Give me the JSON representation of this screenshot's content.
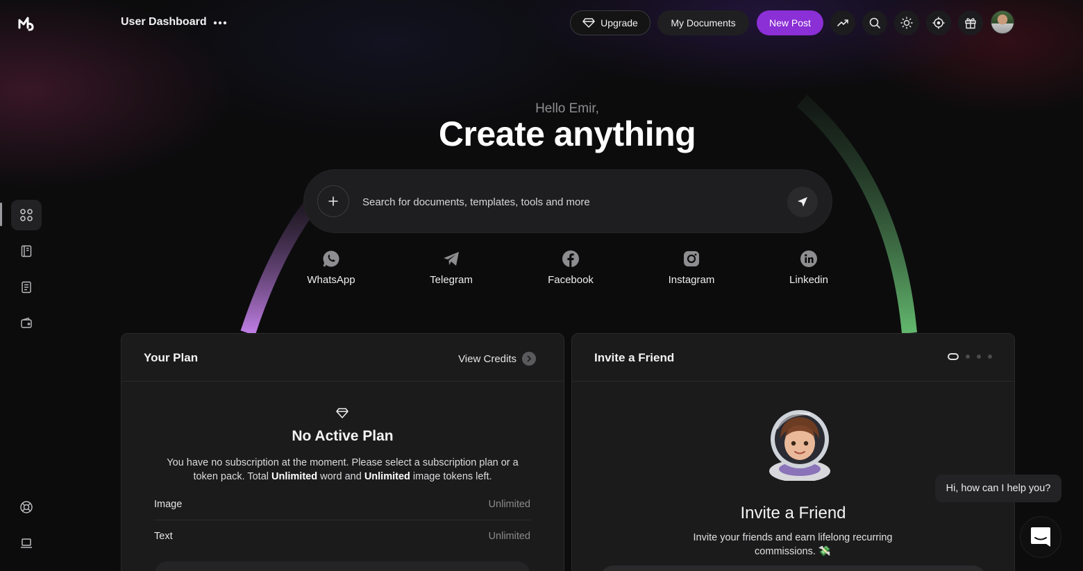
{
  "header": {
    "title": "User Dashboard",
    "upgrade_label": "Upgrade",
    "docs_label": "My Documents",
    "new_post_label": "New Post"
  },
  "sidebar": {
    "items": [
      {
        "icon": "grid-icon",
        "active": true
      },
      {
        "icon": "book-icon"
      },
      {
        "icon": "document-icon"
      },
      {
        "icon": "wallet-icon"
      },
      {
        "icon": "lifebuoy-icon"
      },
      {
        "icon": "laptop-icon"
      }
    ]
  },
  "hero": {
    "greeting": "Hello Emir,",
    "headline": "Create anything",
    "search_placeholder": "Search for documents, templates, tools and more"
  },
  "socials": [
    {
      "label": "WhatsApp",
      "icon": "whatsapp-icon"
    },
    {
      "label": "Telegram",
      "icon": "telegram-icon"
    },
    {
      "label": "Facebook",
      "icon": "facebook-icon"
    },
    {
      "label": "Instagram",
      "icon": "instagram-icon"
    },
    {
      "label": "Linkedin",
      "icon": "linkedin-icon"
    }
  ],
  "plan": {
    "card_title": "Your Plan",
    "view_credits": "View Credits",
    "title": "No Active Plan",
    "desc_1": "You have no subscription at the moment. Please select a subscription plan or a token pack. Total ",
    "unlimited_1": "Unlimited",
    "desc_2": " word and ",
    "unlimited_2": "Unlimited",
    "desc_3": " image tokens left.",
    "rows": [
      {
        "label": "Image",
        "value": "Unlimited"
      },
      {
        "label": "Text",
        "value": "Unlimited"
      }
    ]
  },
  "invite": {
    "card_title": "Invite a Friend",
    "title": "Invite a Friend",
    "desc": "Invite your friends and earn lifelong recurring commissions. 💸"
  },
  "chat": {
    "bubble": "Hi, how can I help you?"
  },
  "colors": {
    "accent": "#8b2fd6",
    "arc_left": "#b57ad9",
    "arc_right": "#5aab67"
  }
}
